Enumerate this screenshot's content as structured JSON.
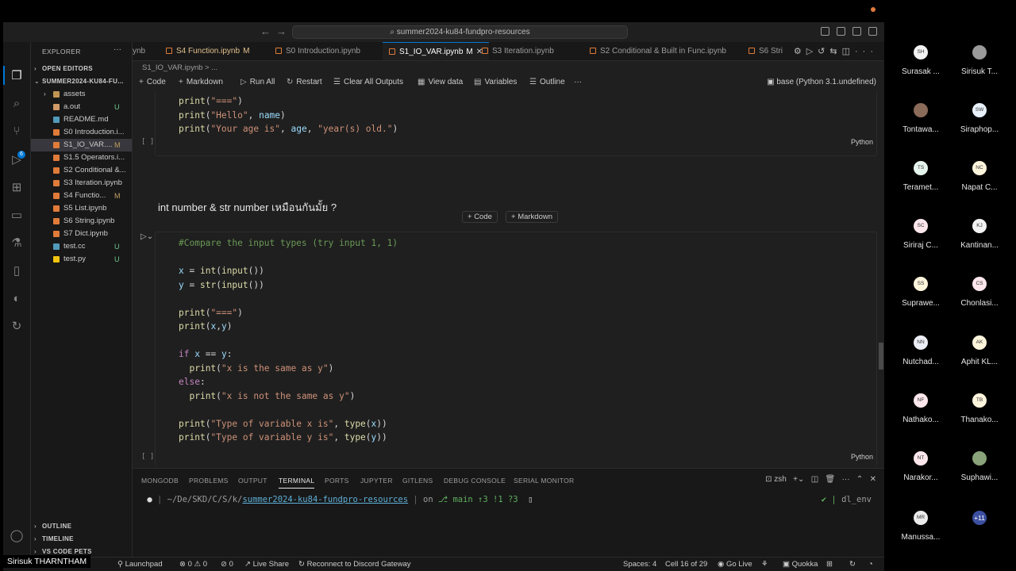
{
  "titlebar": {
    "search_text": "summer2024-ku84-fundpro-resources"
  },
  "sidebar": {
    "title": "EXPLORER",
    "open_editors": "OPEN EDITORS",
    "project": "SUMMER2024-KU84-FU...",
    "files": [
      {
        "name": "assets",
        "status": "",
        "color": "#c09553"
      },
      {
        "name": "a.out",
        "status": "U",
        "color": "#d19a66"
      },
      {
        "name": "README.md",
        "status": "",
        "color": "#519aba"
      },
      {
        "name": "S0 Introduction.i...",
        "status": "",
        "color": "#e07b39"
      },
      {
        "name": "S1_IO_VAR....",
        "status": "M",
        "color": "#e07b39"
      },
      {
        "name": "S1.5 Operators.i...",
        "status": "",
        "color": "#e07b39"
      },
      {
        "name": "S2 Conditional &...",
        "status": "",
        "color": "#e07b39"
      },
      {
        "name": "S3 Iteration.ipynb",
        "status": "",
        "color": "#e07b39"
      },
      {
        "name": "S4 Functio...",
        "status": "M",
        "color": "#e07b39"
      },
      {
        "name": "S5 List.ipynb",
        "status": "",
        "color": "#e07b39"
      },
      {
        "name": "S6 String.ipynb",
        "status": "",
        "color": "#e07b39"
      },
      {
        "name": "S7 Dict.ipynb",
        "status": "",
        "color": "#e07b39"
      },
      {
        "name": "test.cc",
        "status": "U",
        "color": "#519aba"
      },
      {
        "name": "test.py",
        "status": "U",
        "color": "#f1c40f"
      }
    ],
    "outline": "OUTLINE",
    "timeline": "TIMELINE",
    "vscode_pets": "VS CODE PETS"
  },
  "tabs": [
    {
      "label": "ynb",
      "mod": ""
    },
    {
      "label": "S4 Function.ipynb",
      "mod": "M"
    },
    {
      "label": "S0 Introduction.ipynb",
      "mod": ""
    },
    {
      "label": "S1_IO_VAR.ipynb",
      "mod": "M"
    },
    {
      "label": "S3 Iteration.ipynb",
      "mod": ""
    },
    {
      "label": "S2 Conditional & Built in Func.ipynb",
      "mod": ""
    },
    {
      "label": "S6 Stri",
      "mod": ""
    }
  ],
  "breadcrumb": "S1_IO_VAR.ipynb  >  ...",
  "toolbar": {
    "code": "Code",
    "markdown": "Markdown",
    "run_all": "Run All",
    "restart": "Restart",
    "clear": "Clear All Outputs",
    "view_data": "View data",
    "variables": "Variables",
    "outline": "Outline",
    "kernel": "base (Python 3.1.undefined)"
  },
  "cell1": {
    "lang": "Python",
    "exec": "[ ]"
  },
  "markdown_heading": "int number & str number เหมือนกันมั้ย ?",
  "add_code": "Code",
  "add_markdown": "Markdown",
  "cell2": {
    "lang": "Python",
    "exec": "[ ]"
  },
  "panel": {
    "tabs": [
      "MONGODB",
      "PROBLEMS",
      "OUTPUT",
      "TERMINAL",
      "PORTS",
      "JUPYTER",
      "GITLENS",
      "DEBUG CONSOLE",
      "SERIAL MONITOR"
    ],
    "shell": "zsh",
    "prompt_path": "~/De/SKD/C/S/k/",
    "prompt_repo": "summer2024-ku84-fundpro-resources",
    "prompt_on": "on",
    "prompt_branch": "main ↑3 !1 ?3",
    "env": "dl_env"
  },
  "statusbar": {
    "launchpad": "Launchpad",
    "errors": "0",
    "warnings": "0",
    "ports": "0",
    "liveshare": "Live Share",
    "discord": "Reconnect to Discord Gateway",
    "spaces": "Spaces: 4",
    "cell": "Cell 16 of 29",
    "golive": "Go Live",
    "quokka": "Quokka"
  },
  "presenter": "Sirisuk THARNTHAM",
  "participants": [
    {
      "initials": "SH",
      "name": "Surasak ...",
      "color": "#f2f2f2"
    },
    {
      "initials": "",
      "name": "Sirisuk T...",
      "color": "#9a9a9a"
    },
    {
      "initials": "",
      "name": "Tontawa...",
      "color": "#8b6b5a"
    },
    {
      "initials": "SW",
      "name": "Siraphop...",
      "color": "#e8f0fa"
    },
    {
      "initials": "TS",
      "name": "Teramet...",
      "color": "#e6f4ee"
    },
    {
      "initials": "NC",
      "name": "Napat C...",
      "color": "#fdf4dc"
    },
    {
      "initials": "SC",
      "name": "Siriraj C...",
      "color": "#fbe6ec"
    },
    {
      "initials": "KJ",
      "name": "Kantinan...",
      "color": "#f2f2f2"
    },
    {
      "initials": "SS",
      "name": "Suprawe...",
      "color": "#fdf4dc"
    },
    {
      "initials": "CS",
      "name": "Chonlasi...",
      "color": "#fbe6ec"
    },
    {
      "initials": "NN",
      "name": "Nutchad...",
      "color": "#eceef6"
    },
    {
      "initials": "AK",
      "name": "Aphit KL...",
      "color": "#fdf4dc"
    },
    {
      "initials": "NF",
      "name": "Nathako...",
      "color": "#fbe6ec"
    },
    {
      "initials": "TB",
      "name": "Thanako...",
      "color": "#fdf4dc"
    },
    {
      "initials": "NT",
      "name": "Narakor...",
      "color": "#fbe6ec"
    },
    {
      "initials": "",
      "name": "Suphawi...",
      "color": "#8aa37a"
    },
    {
      "initials": "MR",
      "name": "Manussa...",
      "color": "#eaeaea"
    },
    {
      "initials": "+11",
      "name": "",
      "color": "#3b4fa0"
    }
  ]
}
